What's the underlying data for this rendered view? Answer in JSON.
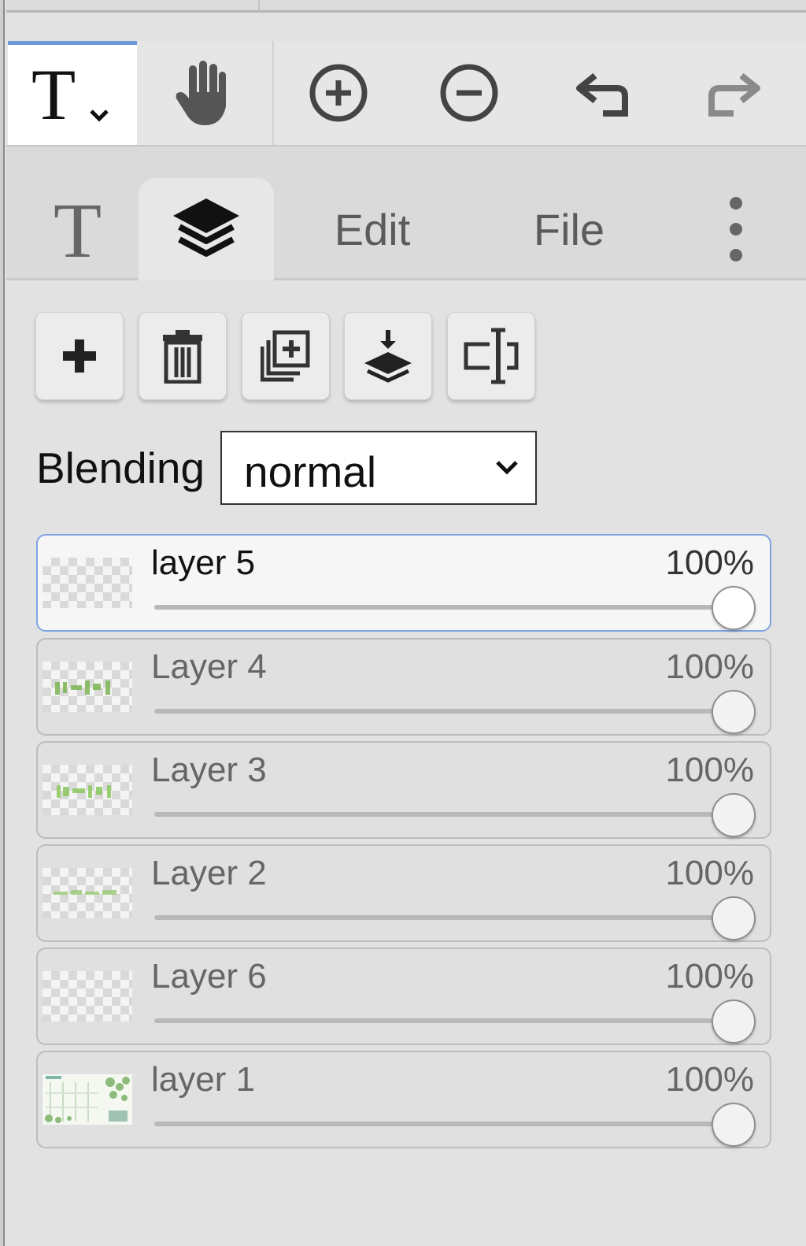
{
  "toolbar": {
    "tools": [
      {
        "name": "text-tool",
        "icon": "text-t-icon",
        "active": true,
        "has_dropdown": true
      },
      {
        "name": "pan-tool",
        "icon": "hand-icon"
      },
      {
        "name": "zoom-in",
        "icon": "zoom-in-icon"
      },
      {
        "name": "zoom-out",
        "icon": "zoom-out-icon"
      },
      {
        "name": "undo",
        "icon": "undo-icon"
      },
      {
        "name": "redo",
        "icon": "redo-icon",
        "disabled": true
      }
    ]
  },
  "tabs": {
    "text_tab_icon": "text-t-icon",
    "layers_tab_icon": "layers-stack-icon",
    "edit_label": "Edit",
    "file_label": "File",
    "more_icon": "vertical-ellipsis-icon",
    "active": "layers"
  },
  "layer_actions": [
    {
      "icon": "plus-icon",
      "name": "add-layer"
    },
    {
      "icon": "trash-icon",
      "name": "delete-layer"
    },
    {
      "icon": "duplicate-icon",
      "name": "duplicate-layer"
    },
    {
      "icon": "merge-down-icon",
      "name": "merge-down"
    },
    {
      "icon": "rename-icon",
      "name": "rename-layer"
    }
  ],
  "blending": {
    "label": "Blending",
    "value": "normal"
  },
  "layers": [
    {
      "name": "layer 5",
      "opacity": "100%",
      "opacity_value": 1.0,
      "selected": true
    },
    {
      "name": "Layer 4",
      "opacity": "100%",
      "opacity_value": 1.0
    },
    {
      "name": "Layer 3",
      "opacity": "100%",
      "opacity_value": 1.0
    },
    {
      "name": "Layer 2",
      "opacity": "100%",
      "opacity_value": 1.0
    },
    {
      "name": "Layer 6",
      "opacity": "100%",
      "opacity_value": 1.0
    },
    {
      "name": "layer 1",
      "opacity": "100%",
      "opacity_value": 1.0
    }
  ],
  "colors": {
    "active_accent": "#6b9bd6",
    "selected_border": "#7fa4e2",
    "thumb_green": "#8fc46a"
  }
}
